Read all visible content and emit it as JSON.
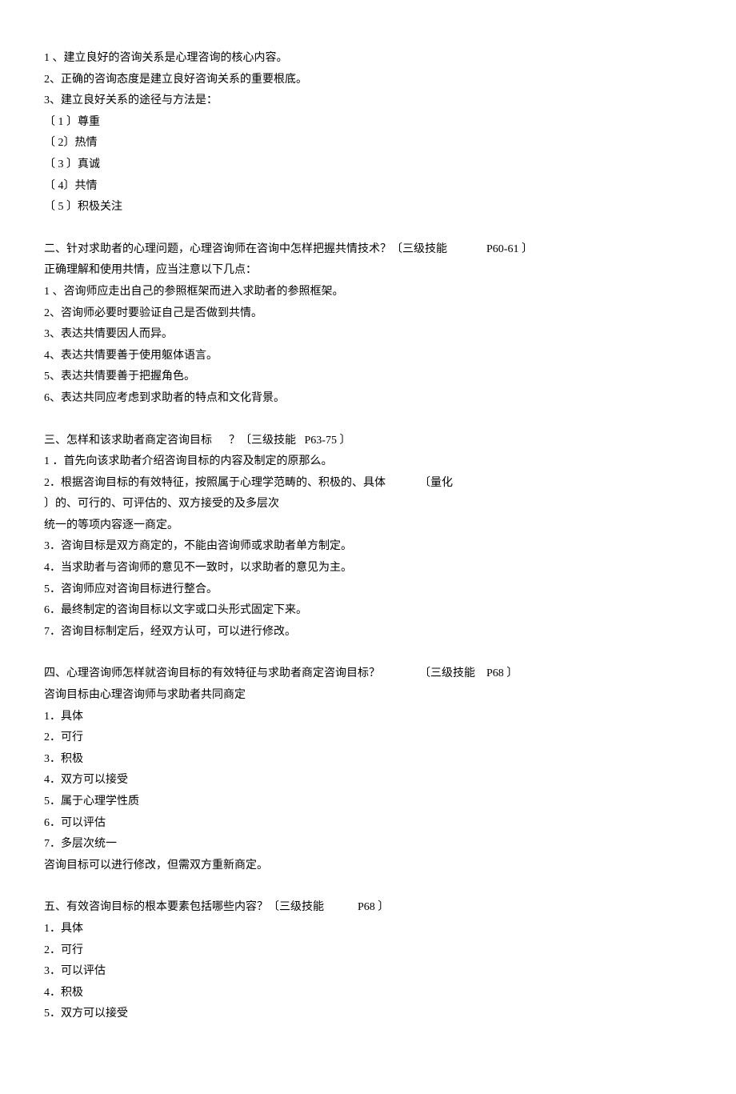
{
  "sections": [
    {
      "lines": [
        "1 、建立良好的咨询关系是心理咨询的核心内容。",
        "2、正确的咨询态度是建立良好咨询关系的重要根底。",
        "3、建立良好关系的途径与方法是：",
        "〔 1 〕尊重",
        "〔 2〕热情",
        "〔 3 〕真诚",
        "〔 4〕共情",
        "〔 5 〕积极关注"
      ]
    },
    {
      "lines": [
        "二、针对求助者的心理问题，心理咨询师在咨询中怎样把握共情技术？〔三级技能              P60-61 〕",
        "正确理解和使用共情，应当注意以下几点：",
        "1 、咨询师应走出自己的参照框架而进入求助者的参照框架。",
        "2、咨询师必要时要验证自己是否做到共情。",
        "3、表达共情要因人而异。",
        "4、表达共情要善于使用躯体语言。",
        "5、表达共情要善于把握角色。",
        "6、表达共同应考虑到求助者的特点和文化背景。"
      ]
    },
    {
      "lines": [
        "三、怎样和该求助者商定咨询目标      ？〔三级技能   P63-75 〕",
        "1 ．首先向该求助者介绍咨询目标的内容及制定的原那么。",
        "2．根据咨询目标的有效特征，按照属于心理学范畴的、积极的、具体            〔量化",
        "〕的、可行的、可评估的、双方接受的及多层次",
        "统一的等项内容逐一商定。",
        "3．咨询目标是双方商定的，不能由咨询师或求助者单方制定。",
        "4．当求助者与咨询师的意见不一致时，以求助者的意见为主。",
        "5．咨询师应对咨询目标进行整合。",
        "6．最终制定的咨询目标以文字或口头形式固定下来。",
        "7．咨询目标制定后，经双方认可，可以进行修改。"
      ]
    },
    {
      "lines": [
        "四、心理咨询师怎样就咨询目标的有效特征与求助者商定咨询目标？              〔三级技能    P68 〕",
        "咨询目标由心理咨询师与求助者共同商定",
        "1．具体",
        "2．可行",
        "3．积极",
        "4．双方可以接受",
        "5．属于心理学性质",
        "6．可以评估",
        "7．多层次统一",
        "咨询目标可以进行修改，但需双方重新商定。"
      ]
    },
    {
      "lines": [
        "五、有效咨询目标的根本要素包括哪些内容？〔三级技能            P68 〕",
        "1．具体",
        "2．可行",
        "3．可以评估",
        "4．积极",
        "5．双方可以接受"
      ]
    }
  ]
}
